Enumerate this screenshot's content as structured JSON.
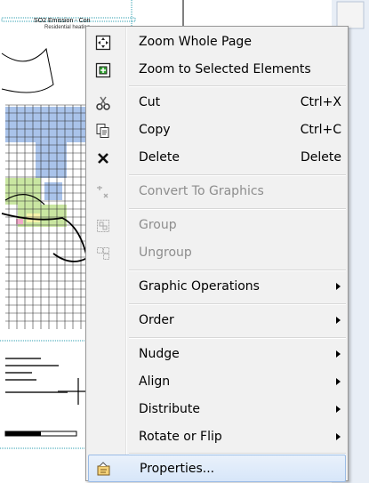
{
  "map": {
    "title": "SO2 Emission - Con",
    "subtitle": "Residential heating"
  },
  "menu": {
    "items": [
      {
        "label": "Zoom Whole Page",
        "icon": "zoom-whole-page-icon"
      },
      {
        "label": "Zoom to Selected Elements",
        "icon": "zoom-selected-icon"
      },
      {
        "label": "Cut",
        "shortcut": "Ctrl+X",
        "icon": "scissors-icon"
      },
      {
        "label": "Copy",
        "shortcut": "Ctrl+C",
        "icon": "copy-icon"
      },
      {
        "label": "Delete",
        "shortcut": "Delete",
        "icon": "delete-x-icon"
      },
      {
        "label": "Convert To Graphics",
        "icon": "convert-graphics-icon",
        "disabled": true
      },
      {
        "label": "Group",
        "icon": "group-icon",
        "disabled": true
      },
      {
        "label": "Ungroup",
        "icon": "ungroup-icon",
        "disabled": true
      },
      {
        "label": "Graphic Operations",
        "submenu": true
      },
      {
        "label": "Order",
        "submenu": true
      },
      {
        "label": "Nudge",
        "submenu": true
      },
      {
        "label": "Align",
        "submenu": true
      },
      {
        "label": "Distribute",
        "submenu": true
      },
      {
        "label": "Rotate or Flip",
        "submenu": true
      },
      {
        "label": "Properties...",
        "icon": "properties-icon",
        "highlighted": true
      }
    ]
  },
  "colors": {
    "menu_bg": "#f1f1f1",
    "highlight_border": "#9bbce6",
    "disabled_text": "#8d8d8d",
    "map_blue": "#a9c3ea",
    "map_green": "#c9e6a1",
    "map_yellow": "#f6f3a9",
    "map_pink": "#f1a9c9"
  }
}
